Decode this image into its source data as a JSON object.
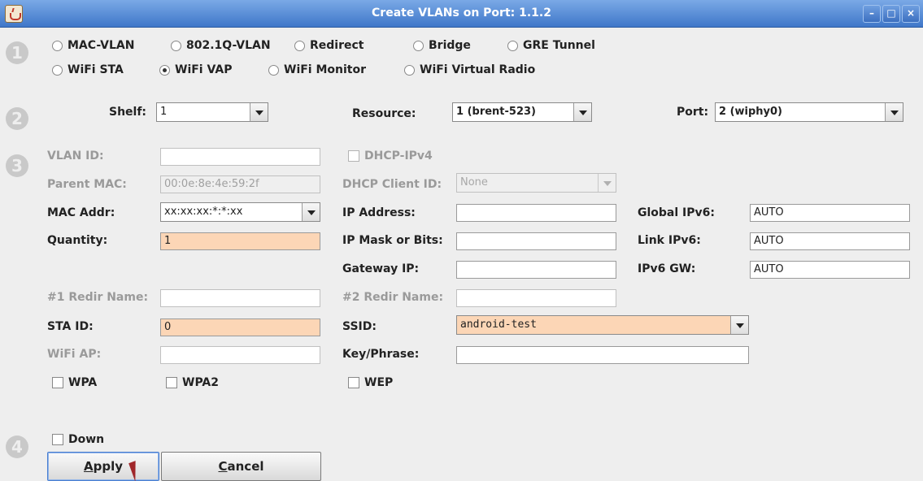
{
  "window": {
    "title": "Create VLANs on Port: 1.1.2"
  },
  "steps": [
    "1",
    "2",
    "3",
    "4"
  ],
  "vlan_types": {
    "row1": [
      "MAC-VLAN",
      "802.1Q-VLAN",
      "Redirect",
      "Bridge",
      "GRE Tunnel"
    ],
    "row2": [
      "WiFi STA",
      "WiFi VAP",
      "WiFi Monitor",
      "WiFi Virtual Radio"
    ],
    "selected": "WiFi VAP"
  },
  "location": {
    "shelf_label": "Shelf:",
    "shelf_value": "1",
    "resource_label": "Resource:",
    "resource_value": "1 (brent-523)",
    "port_label": "Port:",
    "port_value": "2 (wiphy0)"
  },
  "form": {
    "vlan_id_label": "VLAN ID:",
    "vlan_id_value": "",
    "parent_mac_label": "Parent MAC:",
    "parent_mac_value": "00:0e:8e:4e:59:2f",
    "mac_addr_label": "MAC Addr:",
    "mac_addr_value": "xx:xx:xx:*:*:xx",
    "quantity_label": "Quantity:",
    "quantity_value": "1",
    "dhcp_ipv4_label": "DHCP-IPv4",
    "dhcp_client_id_label": "DHCP Client ID:",
    "dhcp_client_id_value": "None",
    "ip_address_label": "IP Address:",
    "ip_address_value": "",
    "ip_mask_label": "IP Mask or Bits:",
    "ip_mask_value": "",
    "gateway_ip_label": "Gateway IP:",
    "gateway_ip_value": "",
    "global_ipv6_label": "Global IPv6:",
    "global_ipv6_value": "AUTO",
    "link_ipv6_label": "Link IPv6:",
    "link_ipv6_value": "AUTO",
    "ipv6_gw_label": "IPv6 GW:",
    "ipv6_gw_value": "AUTO",
    "redir1_label": "#1 Redir Name:",
    "redir1_value": "",
    "redir2_label": "#2 Redir Name:",
    "redir2_value": "",
    "sta_id_label": "STA ID:",
    "sta_id_value": "0",
    "ssid_label": "SSID:",
    "ssid_value": "android-test",
    "wifi_ap_label": "WiFi AP:",
    "wifi_ap_value": "",
    "key_phrase_label": "Key/Phrase:",
    "key_phrase_value": "",
    "wpa_label": "WPA",
    "wpa2_label": "WPA2",
    "wep_label": "WEP"
  },
  "footer": {
    "down_label": "Down",
    "apply_prefix": "A",
    "apply_rest": "pply",
    "cancel_prefix": "C",
    "cancel_rest": "ancel"
  },
  "colors": {
    "titlebar": "#3f77c9",
    "highlight_field": "#fcd6b6",
    "background": "#eeeeee"
  }
}
